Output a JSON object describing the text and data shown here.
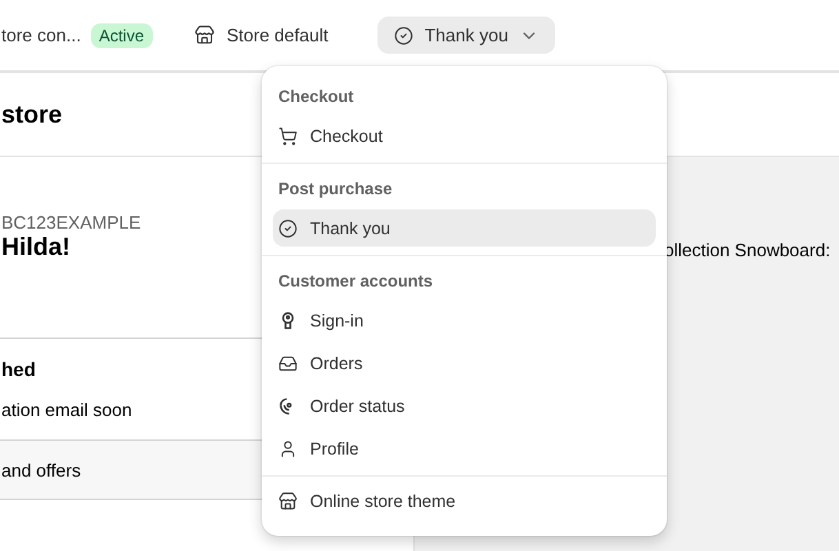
{
  "top_bar": {
    "store_name": "tore con...",
    "status_badge": "Active",
    "theme_label": "Store default",
    "page_select": {
      "label": "Thank you",
      "expanded": true
    }
  },
  "left_panel": {
    "title": "store",
    "order_id": "BC123EXAMPLE",
    "greeting": "Hilda!",
    "section_heading": "hed",
    "section_text": "ation email soon",
    "offers_row": "and offers"
  },
  "preview": {
    "text": "ollection Snowboard:"
  },
  "menu": [
    {
      "heading": "Checkout",
      "items": [
        {
          "label": "Checkout",
          "selected": false
        }
      ]
    },
    {
      "heading": "Post purchase",
      "items": [
        {
          "label": "Thank you",
          "selected": true
        }
      ]
    },
    {
      "heading": "Customer accounts",
      "items": [
        {
          "label": "Sign-in",
          "selected": false
        },
        {
          "label": "Orders",
          "selected": false
        },
        {
          "label": "Order status",
          "selected": false
        },
        {
          "label": "Profile",
          "selected": false
        }
      ]
    },
    {
      "items": [
        {
          "label": "Online store theme",
          "selected": false
        }
      ]
    }
  ]
}
